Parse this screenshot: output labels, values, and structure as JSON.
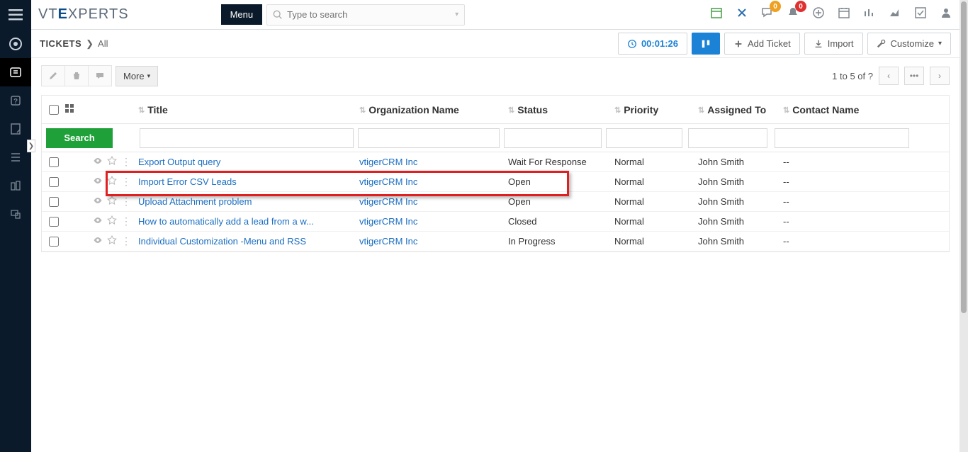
{
  "sidebar_icons": [
    "menu",
    "dashboard",
    "tickets",
    "faq",
    "notes",
    "calendar",
    "org",
    "devices"
  ],
  "header": {
    "logo_prefix": "VT",
    "logo_mid": "E",
    "logo_suffix": "XPERTS",
    "menu_label": "Menu",
    "search_placeholder": "Type to search"
  },
  "top_badges": {
    "chat": "0",
    "bell": "0"
  },
  "subheader": {
    "module": "TICKETS",
    "crumb": "All",
    "timer": "00:01:26",
    "add_label": "Add Ticket",
    "import_label": "Import",
    "customize_label": "Customize"
  },
  "actions": {
    "more_label": "More",
    "pager_text": "1 to 5  of ?",
    "pager_dots": "•••"
  },
  "columns": {
    "title": "Title",
    "org": "Organization Name",
    "status": "Status",
    "priority": "Priority",
    "assigned": "Assigned To",
    "contact": "Contact Name"
  },
  "search_button": "Search",
  "rows": [
    {
      "title": "Export Output query",
      "org": "vtigerCRM Inc",
      "status": "Wait For Response",
      "priority": "Normal",
      "assigned": "John Smith",
      "contact": "--",
      "highlight": false
    },
    {
      "title": "Import Error CSV Leads",
      "org": "vtigerCRM Inc",
      "status": "Open",
      "priority": "Normal",
      "assigned": "John Smith",
      "contact": "--",
      "highlight": true
    },
    {
      "title": "Upload Attachment problem",
      "org": "vtigerCRM Inc",
      "status": "Open",
      "priority": "Normal",
      "assigned": "John Smith",
      "contact": "--",
      "highlight": false
    },
    {
      "title": "How to automatically add a lead from a w...",
      "org": "vtigerCRM Inc",
      "status": "Closed",
      "priority": "Normal",
      "assigned": "John Smith",
      "contact": "--",
      "highlight": false
    },
    {
      "title": "Individual Customization -Menu and RSS",
      "org": "vtigerCRM Inc",
      "status": "In Progress",
      "priority": "Normal",
      "assigned": "John Smith",
      "contact": "--",
      "highlight": false
    }
  ]
}
